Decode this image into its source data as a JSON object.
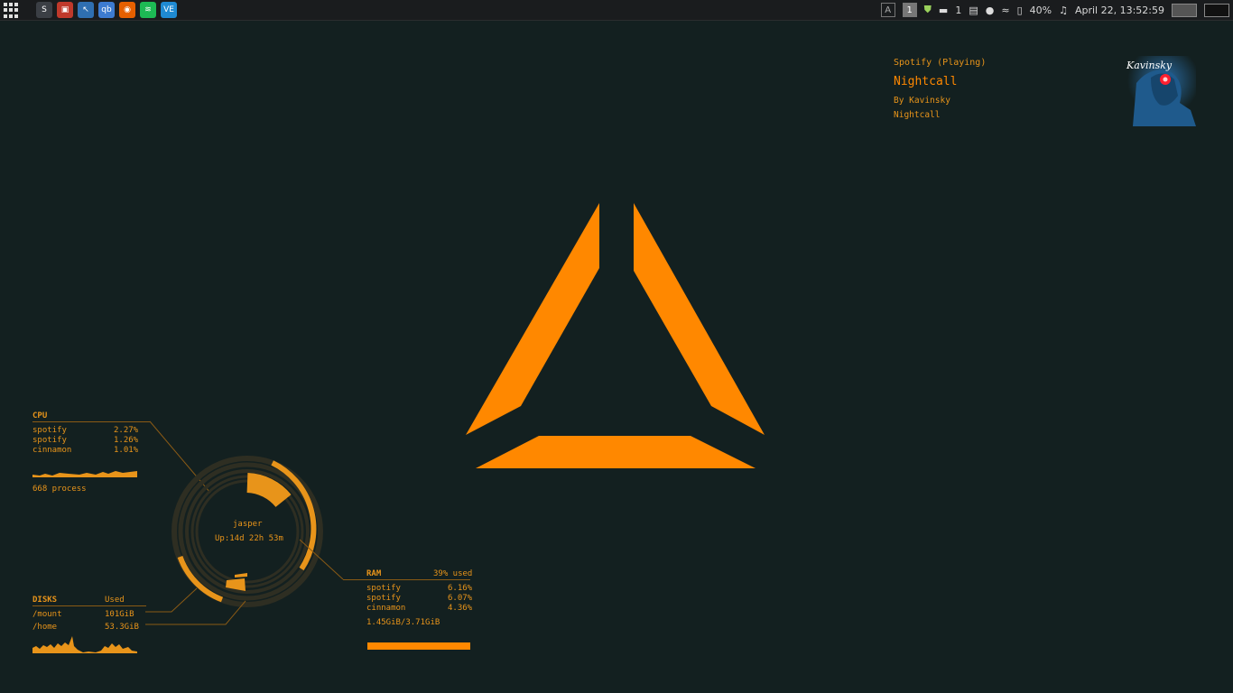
{
  "panel": {
    "launchers": [
      {
        "icon": "sublime-text-icon",
        "glyph": "S",
        "color": "#3b3f45"
      },
      {
        "icon": "terminal-icon",
        "glyph": "▣",
        "color": "#c0392b"
      },
      {
        "icon": "mouse-settings-icon",
        "glyph": "↖",
        "color": "#2f6fb1"
      },
      {
        "icon": "qbittorrent-icon",
        "glyph": "qb",
        "color": "#3d7bd1"
      },
      {
        "icon": "firefox-icon",
        "glyph": "◉",
        "color": "#e66000"
      },
      {
        "icon": "spotify-icon",
        "glyph": "≋",
        "color": "#1db954"
      },
      {
        "icon": "vscode-icon",
        "glyph": "VE",
        "color": "#1f8ad2"
      }
    ],
    "workspaces": [
      "A",
      "1"
    ],
    "notification_count": "1",
    "battery": "40%",
    "clock": "April 22, 13:52:59"
  },
  "spotify": {
    "status": "Spotify (Playing)",
    "title": "Nightcall",
    "artist": "By Kavinsky",
    "album": "Nightcall",
    "cover_logo": "Kavinsky"
  },
  "cpu": {
    "label": "CPU",
    "processes": [
      {
        "name": "spotify",
        "value": "2.27%"
      },
      {
        "name": "spotify",
        "value": "1.26%"
      },
      {
        "name": "cinnamon",
        "value": "1.01%"
      }
    ],
    "process_count": "668 process"
  },
  "center": {
    "host": "jasper",
    "uptime": "Up:14d 22h 53m"
  },
  "disks": {
    "label": "DISKS",
    "used_label": "Used",
    "mounts": [
      {
        "path": "/mount",
        "used": "101GiB"
      },
      {
        "path": "/home",
        "used": "53.3GiB"
      }
    ]
  },
  "ram": {
    "label": "RAM",
    "used_pct": "39% used",
    "processes": [
      {
        "name": "spotify",
        "value": "6.16%"
      },
      {
        "name": "spotify",
        "value": "6.07%"
      },
      {
        "name": "cinnamon",
        "value": "4.36%"
      }
    ],
    "total": "1.45GiB/3.71GiB",
    "bar_fraction": 1.0
  },
  "colors": {
    "accent": "#ff8800",
    "text": "#e8941a",
    "background": "#132020"
  }
}
